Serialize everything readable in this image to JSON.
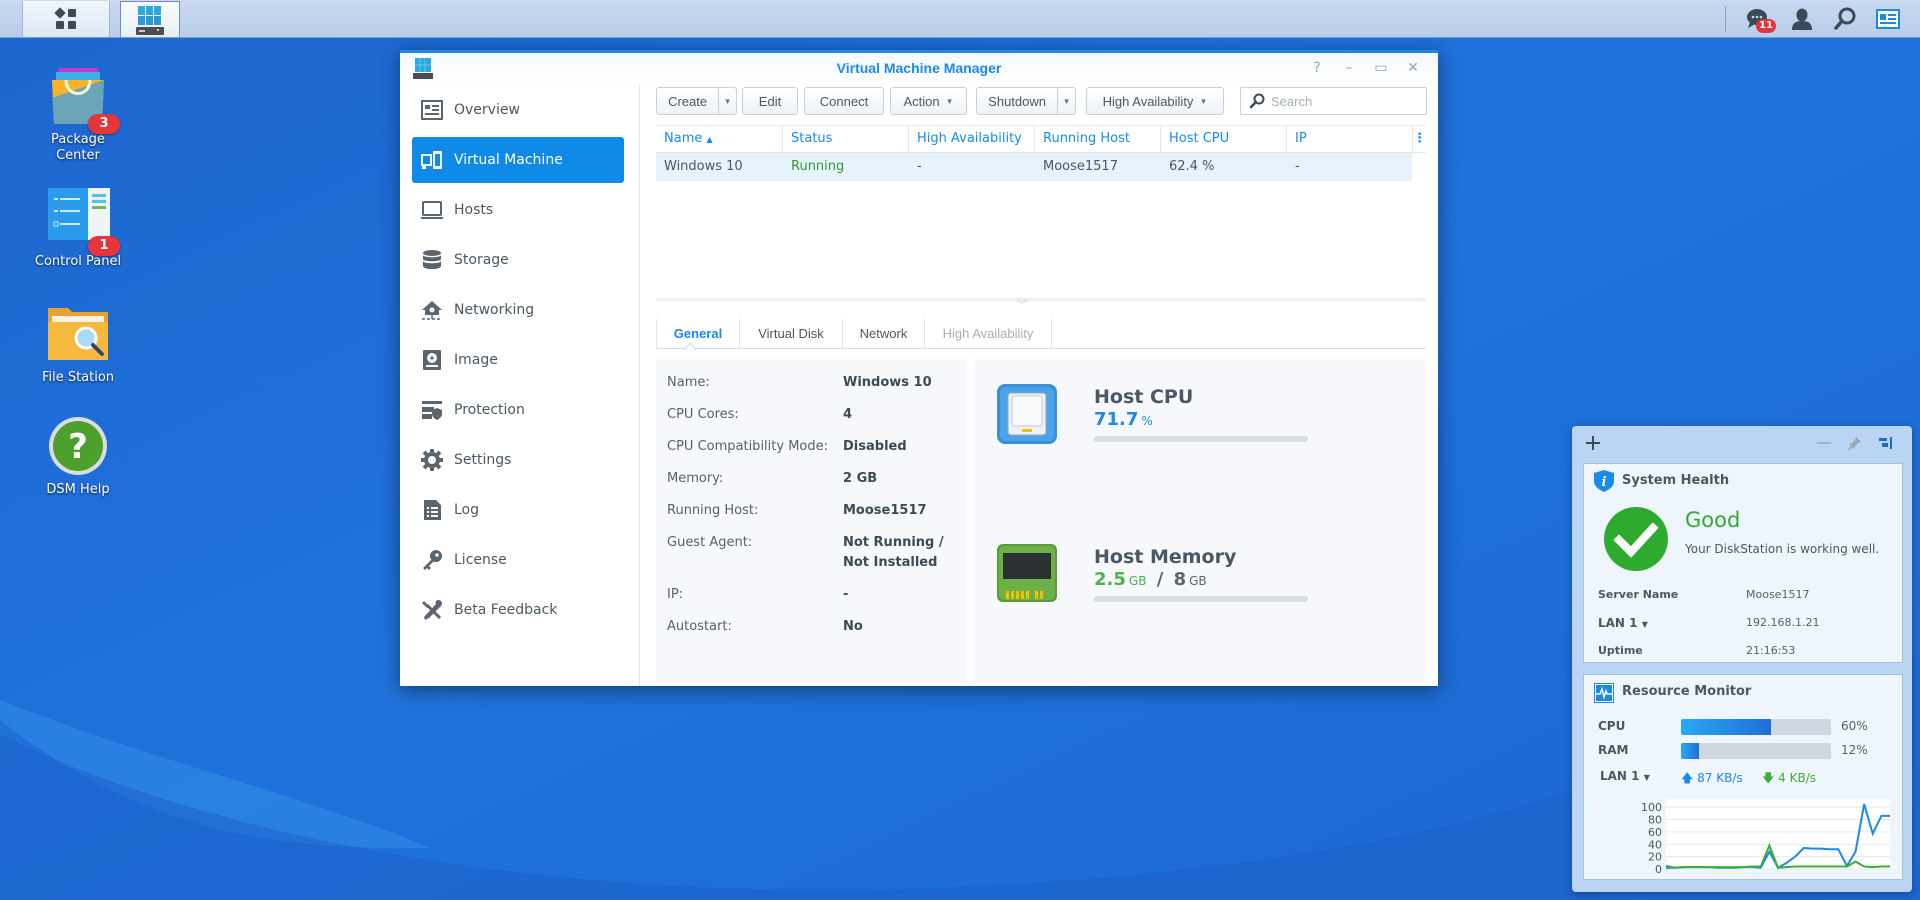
{
  "taskbar": {
    "main_menu_icon": "main-menu-icon",
    "open_app_icon": "virtual-machine-manager-icon",
    "notification_count": "11",
    "right_icons": [
      "notifications-icon",
      "user-icon",
      "search-icon",
      "widgets-icon"
    ]
  },
  "desktop": {
    "icons": [
      {
        "label": "Package\nCenter",
        "badge": "3",
        "icon": "package-center-icon"
      },
      {
        "label": "Control Panel",
        "badge": "1",
        "icon": "control-panel-icon"
      },
      {
        "label": "File Station",
        "badge": null,
        "icon": "file-station-icon"
      },
      {
        "label": "DSM Help",
        "badge": null,
        "icon": "dsm-help-icon"
      }
    ]
  },
  "window": {
    "title": "Virtual Machine Manager",
    "controls": {
      "help": "?",
      "minimize": "–",
      "maximize": "▭",
      "close": "✕"
    }
  },
  "sidebar": {
    "items": [
      {
        "label": "Overview",
        "icon": "overview-icon",
        "active": false
      },
      {
        "label": "Virtual Machine",
        "icon": "virtual-machine-icon",
        "active": true
      },
      {
        "label": "Hosts",
        "icon": "hosts-icon",
        "active": false
      },
      {
        "label": "Storage",
        "icon": "storage-icon",
        "active": false
      },
      {
        "label": "Networking",
        "icon": "networking-icon",
        "active": false
      },
      {
        "label": "Image",
        "icon": "image-icon",
        "active": false
      },
      {
        "label": "Protection",
        "icon": "protection-icon",
        "active": false
      },
      {
        "label": "Settings",
        "icon": "settings-icon",
        "active": false
      },
      {
        "label": "Log",
        "icon": "log-icon",
        "active": false
      },
      {
        "label": "License",
        "icon": "license-icon",
        "active": false
      },
      {
        "label": "Beta Feedback",
        "icon": "beta-feedback-icon",
        "active": false
      }
    ]
  },
  "toolbar": {
    "create": "Create",
    "edit": "Edit",
    "connect": "Connect",
    "action": "Action",
    "shutdown": "Shutdown",
    "high_availability": "High Availability",
    "search_placeholder": "Search",
    "search_value": ""
  },
  "grid": {
    "columns": [
      "Name",
      "Status",
      "High Availability",
      "Running Host",
      "Host CPU",
      "IP"
    ],
    "sort_indicator": "▲",
    "rows": [
      {
        "name": "Windows 10",
        "status": "Running",
        "high_availability": "-",
        "running_host": "Moose1517",
        "host_cpu": "62.4 %",
        "ip": "-"
      }
    ]
  },
  "tabs": [
    {
      "label": "General",
      "state": "active"
    },
    {
      "label": "Virtual Disk",
      "state": "normal"
    },
    {
      "label": "Network",
      "state": "normal"
    },
    {
      "label": "High Availability",
      "state": "disabled"
    }
  ],
  "general": {
    "fields": [
      {
        "label": "Name:",
        "value": "Windows 10"
      },
      {
        "label": "CPU Cores:",
        "value": "4"
      },
      {
        "label": "CPU Compatibility Mode:",
        "value": "Disabled"
      },
      {
        "label": "Memory:",
        "value": "2 GB"
      },
      {
        "label": "Running Host:",
        "value": "Moose1517"
      },
      {
        "label": "Guest Agent:",
        "value": "Not Running / Not Installed"
      },
      {
        "label": "IP:",
        "value": "-"
      },
      {
        "label": "Autostart:",
        "value": "No"
      }
    ]
  },
  "resources": {
    "cpu": {
      "title": "Host CPU",
      "value": "71.7",
      "unit": "%",
      "percent": 0,
      "color": "#1a8ae6"
    },
    "memory": {
      "title": "Host Memory",
      "used": "2.5",
      "used_unit": "GB",
      "separator": "/",
      "total": "8",
      "total_unit": "GB",
      "percent": 0,
      "color": "#4caf50"
    }
  },
  "widgets": {
    "controls": [
      "add-widget-icon",
      "minimize-icon",
      "pin-icon",
      "dock-icon"
    ],
    "system_health": {
      "title": "System Health",
      "status": "Good",
      "message": "Your DiskStation is working well.",
      "server_name_label": "Server Name",
      "server_name": "Moose1517",
      "lan_label": "LAN 1",
      "lan_ip": "192.168.1.21",
      "uptime_label": "Uptime",
      "uptime": "21:16:53",
      "status_color": "#2eaa2e"
    },
    "resource_monitor": {
      "title": "Resource Monitor",
      "cpu_label": "CPU",
      "cpu_percent": 60,
      "cpu_text": "60%",
      "ram_label": "RAM",
      "ram_percent": 12,
      "ram_text": "12%",
      "lan_label": "LAN 1",
      "upload": "87 KB/s",
      "download": "4 KB/s"
    }
  },
  "chart_data": {
    "type": "line",
    "title": "",
    "xlabel": "",
    "ylabel": "",
    "ylim": [
      0,
      100
    ],
    "yticks": [
      0,
      20,
      40,
      60,
      80,
      100
    ],
    "grid": true,
    "x": [
      0,
      1,
      2,
      3,
      4,
      5,
      6,
      7,
      8,
      9,
      10,
      11,
      12,
      13,
      14,
      15,
      16,
      17,
      18,
      19,
      20,
      21,
      22,
      23,
      24,
      25,
      26
    ],
    "series": [
      {
        "name": "upload",
        "color": "#1a8ae6",
        "values": [
          2,
          2,
          3,
          3,
          3,
          3,
          2,
          2,
          2,
          3,
          3,
          2,
          28,
          2,
          10,
          20,
          34,
          33,
          33,
          32,
          32,
          5,
          28,
          105,
          57,
          86,
          86
        ]
      },
      {
        "name": "download",
        "color": "#3cb034",
        "values": [
          5,
          2,
          3,
          3,
          3,
          3,
          3,
          3,
          3,
          3,
          4,
          4,
          38,
          2,
          3,
          4,
          4,
          4,
          4,
          4,
          4,
          4,
          12,
          4,
          3,
          4,
          4
        ]
      }
    ]
  }
}
